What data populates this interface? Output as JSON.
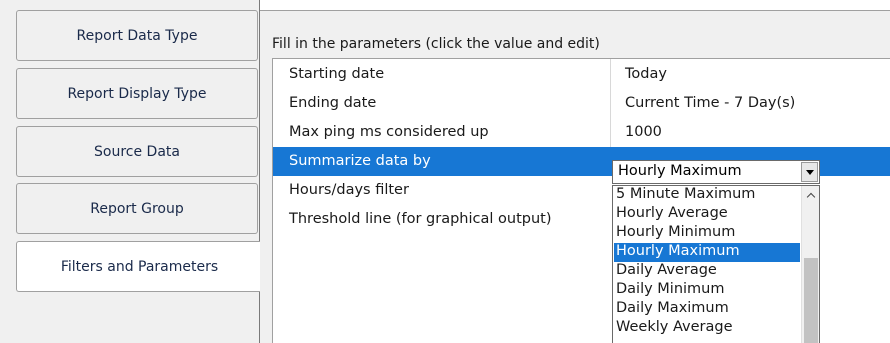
{
  "tabs": [
    {
      "label": "Report Data Type",
      "active": false
    },
    {
      "label": "Report Display Type",
      "active": false
    },
    {
      "label": "Source Data",
      "active": false
    },
    {
      "label": "Report Group",
      "active": false
    },
    {
      "label": "Filters and Parameters",
      "active": true
    }
  ],
  "instructions": "Fill in the parameters (click the value and edit)",
  "parameters": [
    {
      "name": "Starting date",
      "value": "Today"
    },
    {
      "name": "Ending date",
      "value": "Current Time - 7 Day(s)"
    },
    {
      "name": "Max ping ms considered up",
      "value": "1000"
    },
    {
      "name": "Summarize data by",
      "value": ""
    },
    {
      "name": "Hours/days filter",
      "value": ""
    },
    {
      "name": "Threshold line (for graphical output)",
      "value": ""
    }
  ],
  "combo": {
    "selected": "Hourly Maximum",
    "options": [
      "5 Minute Maximum",
      "Hourly Average",
      "Hourly Minimum",
      "Hourly Maximum",
      "Daily Average",
      "Daily Minimum",
      "Daily Maximum",
      "Weekly Average"
    ],
    "highlighted_index": 3
  },
  "colors": {
    "selection": "#1777d4",
    "panel_bg": "#f0f0f0",
    "tab_text": "#1a2a4a"
  }
}
